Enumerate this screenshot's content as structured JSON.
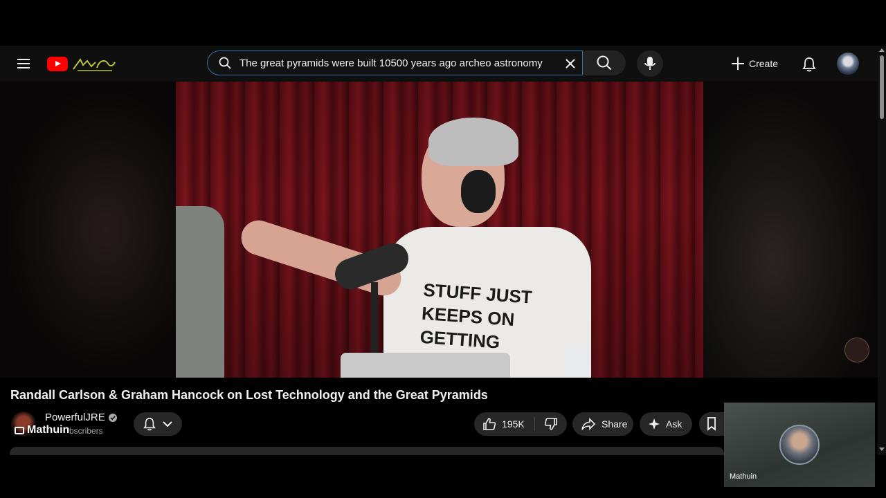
{
  "search": {
    "query": "The great pyramids were built 10500 years ago archeo astronomy"
  },
  "header": {
    "create_label": "Create"
  },
  "video": {
    "title": "Randall Carlson & Graham Hancock on Lost Technology and the Great Pyramids",
    "shirt_text": "STUFF JUST KEEPS ON GETTING"
  },
  "channel": {
    "name": "PowerfulJRE",
    "subscribers": "bscribers",
    "overlay_name": "Mathuin"
  },
  "actions": {
    "like_count": "195K",
    "share_label": "Share",
    "ask_label": "Ask"
  },
  "camera_tile": {
    "name": "Mathuin"
  },
  "icons": [
    "menu-icon",
    "youtube-logo",
    "search-icon",
    "close-icon",
    "mic-icon",
    "plus-icon",
    "bell-icon",
    "chevron-down-icon",
    "thumbs-up-icon",
    "thumbs-down-icon",
    "share-icon",
    "sparkle-icon",
    "bookmark-icon",
    "verified-icon",
    "cast-icon"
  ],
  "colors": {
    "brand_red": "#ff0000",
    "background": "#0f0f0f",
    "pill": "#272727",
    "search_focus_border": "#3a6ea8"
  }
}
